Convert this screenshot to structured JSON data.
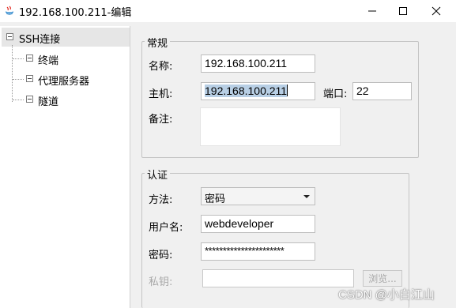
{
  "window": {
    "title": "192.168.100.211-编辑",
    "controls": [
      "minimize",
      "maximize",
      "close"
    ]
  },
  "tree": {
    "root": "SSH连接",
    "children": [
      "终端",
      "代理服务器",
      "隧道"
    ]
  },
  "general": {
    "group_title": "常规",
    "name_label": "名称:",
    "name_value": "192.168.100.211",
    "host_label": "主机:",
    "host_value": "192.168.100.211",
    "port_label": "端口:",
    "port_value": "22",
    "notes_label": "备注:",
    "notes_value": ""
  },
  "auth": {
    "group_title": "认证",
    "method_label": "方法:",
    "method_value": "密码",
    "user_label": "用户名:",
    "user_value": "webdeveloper",
    "password_label": "密码:",
    "password_value": "**********************",
    "key_label": "私钥:",
    "key_value": "",
    "browse_label": "浏览..."
  },
  "watermark": "CSDN @小白江山"
}
